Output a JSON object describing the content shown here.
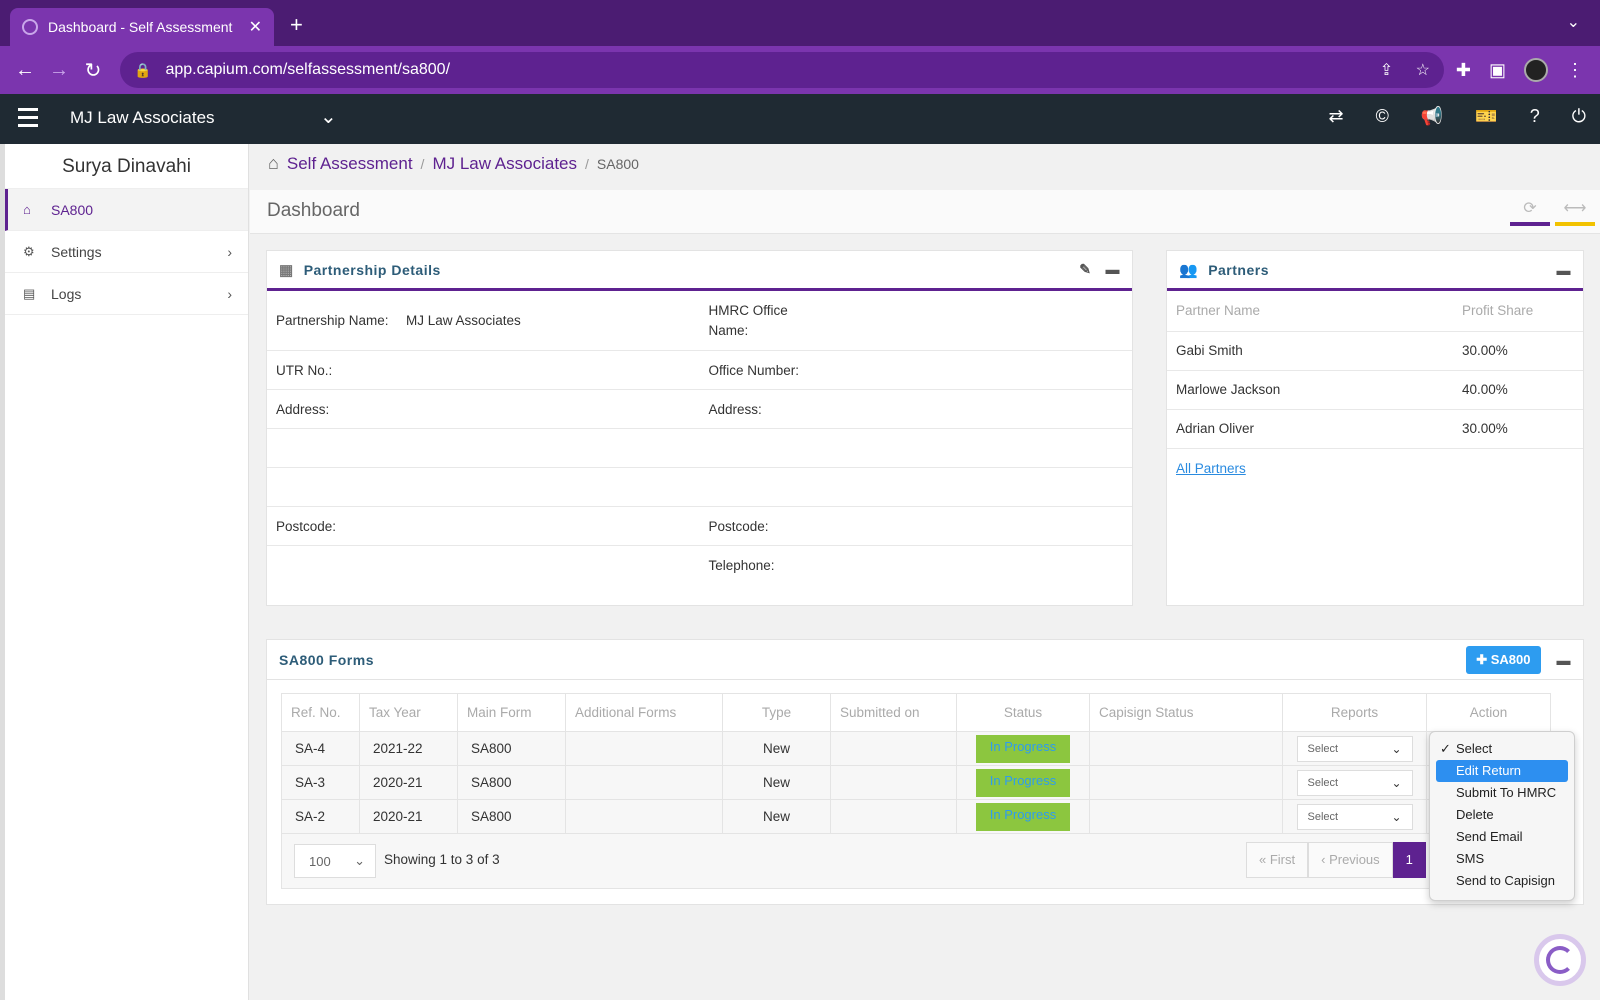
{
  "browser": {
    "tab_title": "Dashboard - Self Assessment",
    "url": "app.capium.com/selfassessment/sa800/"
  },
  "header": {
    "client_name": "MJ Law Associates"
  },
  "sidebar": {
    "user_name": "Surya Dinavahi",
    "items": [
      {
        "label": "SA800"
      },
      {
        "label": "Settings"
      },
      {
        "label": "Logs"
      }
    ]
  },
  "breadcrumb": {
    "items": [
      "Self Assessment",
      "MJ Law Associates"
    ],
    "current": "SA800"
  },
  "dashboard": {
    "title": "Dashboard"
  },
  "partnership": {
    "title": "Partnership Details",
    "name_label": "Partnership Name:",
    "name_value": "MJ Law Associates",
    "hmrc_office_label": "HMRC Office Name:",
    "utr_label": "UTR No.:",
    "office_number_label": "Office Number:",
    "address_label": "Address:",
    "hmrc_address_label": "Address:",
    "postcode_label": "Postcode:",
    "hmrc_postcode_label": "Postcode:",
    "telephone_label": "Telephone:"
  },
  "partners": {
    "title": "Partners",
    "col_name": "Partner Name",
    "col_share": "Profit Share",
    "rows": [
      {
        "name": "Gabi Smith",
        "share": "30.00%"
      },
      {
        "name": "Marlowe Jackson",
        "share": "40.00%"
      },
      {
        "name": "Adrian Oliver",
        "share": "30.00%"
      }
    ],
    "all_link": "All Partners"
  },
  "forms": {
    "title": "SA800 Forms",
    "add_button": "SA800",
    "columns": [
      "Ref. No.",
      "Tax Year",
      "Main Form",
      "Additional Forms",
      "Type",
      "Submitted on",
      "Status",
      "Capisign Status",
      "Reports",
      "Action"
    ],
    "rows": [
      {
        "ref": "SA-4",
        "year": "2021-22",
        "form": "SA800",
        "additional": "",
        "type": "New",
        "submitted": "",
        "status": "In Progress",
        "capisign": "",
        "reports": "Select"
      },
      {
        "ref": "SA-3",
        "year": "2020-21",
        "form": "SA800",
        "additional": "",
        "type": "New",
        "submitted": "",
        "status": "In Progress",
        "capisign": "",
        "reports": "Select"
      },
      {
        "ref": "SA-2",
        "year": "2020-21",
        "form": "SA800",
        "additional": "",
        "type": "New",
        "submitted": "",
        "status": "In Progress",
        "capisign": "",
        "reports": "Select"
      }
    ],
    "page_size": "100",
    "showing": "Showing 1 to 3 of 3",
    "pager": {
      "first": "First",
      "previous": "Previous",
      "current": "1"
    }
  },
  "action_menu": {
    "options": [
      "Select",
      "Edit Return",
      "Submit To HMRC",
      "Delete",
      "Send Email",
      "SMS",
      "Send to Capisign"
    ],
    "checked": "Select",
    "highlighted": "Edit Return"
  },
  "colors": {
    "brand_purple": "#5e2290",
    "status_green": "#8cc63f",
    "accent_blue": "#2d9cf0",
    "header_dark": "#1f2a33"
  }
}
